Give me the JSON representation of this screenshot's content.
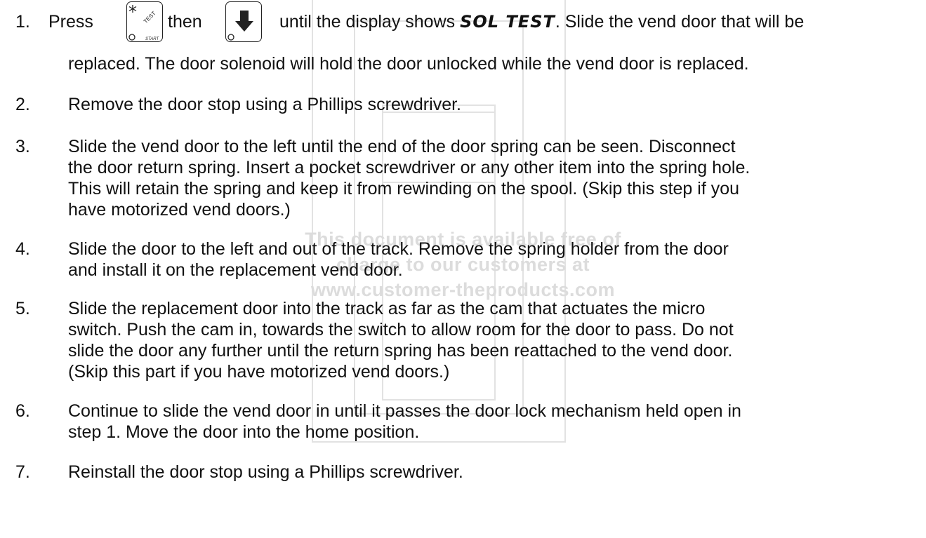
{
  "watermark": {
    "line1": "This document is available free of",
    "line2": "charge to our customers at",
    "line3": "www.customer-theproducts.com"
  },
  "steps": [
    {
      "number": "1.",
      "press": "Press",
      "then": "then",
      "until": "until the display shows",
      "display": "SOL TEST",
      "after_display": ". Slide the vend door that will be",
      "continuation": "replaced. The door solenoid will hold the door unlocked while the vend door is replaced.",
      "key1": {
        "icon": "test-start-key-icon",
        "label_top": "TEST",
        "label_bottom": "START"
      },
      "key2": {
        "icon": "down-arrow-key-icon"
      }
    },
    {
      "number": "2.",
      "text": "Remove the door stop using a Phillips screwdriver."
    },
    {
      "number": "3.",
      "lines": [
        "Slide the vend door to the left until the end of the door spring can be seen. Disconnect",
        "the door return spring. Insert a pocket screwdriver or any other item into the spring hole.",
        "This will retain the spring and keep it from rewinding on the spool. (Skip this step if you",
        "have motorized vend doors.)"
      ]
    },
    {
      "number": "4.",
      "lines": [
        "Slide the door to the left and out of the track. Remove the spring holder from the door",
        "and install it on the replacement vend door."
      ]
    },
    {
      "number": "5.",
      "lines": [
        "Slide the replacement door into the track as far as the cam that actuates the micro",
        "switch. Push the cam in, towards the switch to allow room for the door to pass. Do not",
        "slide the door any further until the return spring has been reattached to the vend door.",
        "(Skip this part if you have motorized vend doors.)"
      ]
    },
    {
      "number": "6.",
      "lines": [
        "Continue to slide the vend door in until it passes the door lock mechanism held open in",
        "step 1. Move the door into the home position."
      ]
    },
    {
      "number": "7.",
      "text": "Reinstall the door stop using a Phillips screwdriver."
    }
  ]
}
